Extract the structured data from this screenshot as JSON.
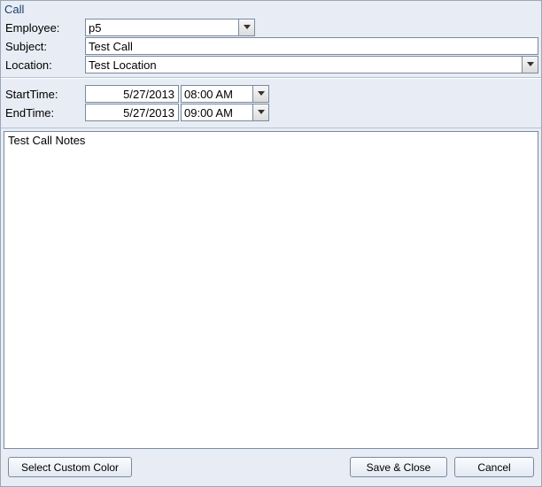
{
  "dialog": {
    "title": "Call"
  },
  "fields": {
    "employee": {
      "label": "Employee:",
      "value": "p5"
    },
    "subject": {
      "label": "Subject:",
      "value": "Test Call"
    },
    "location": {
      "label": "Location:",
      "value": "Test Location"
    },
    "start": {
      "label": "StartTime:",
      "date": "5/27/2013",
      "time": "08:00 AM"
    },
    "end": {
      "label": "EndTime:",
      "date": "5/27/2013",
      "time": "09:00 AM"
    }
  },
  "notes": {
    "value": "Test Call Notes"
  },
  "buttons": {
    "custom_color": "Select Custom Color",
    "save_close": "Save & Close",
    "cancel": "Cancel"
  }
}
